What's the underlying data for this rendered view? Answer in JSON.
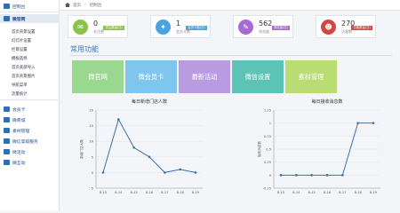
{
  "sidebar": {
    "items": [
      {
        "label": "控制台",
        "icon": "dashboard-icon",
        "type": "top",
        "active": false
      },
      {
        "label": "微官网",
        "icon": "home-site-icon",
        "type": "top",
        "active": true
      },
      {
        "label": "首页背景设置",
        "type": "sub"
      },
      {
        "label": "幻灯片设置",
        "type": "sub"
      },
      {
        "label": "栏目设置",
        "type": "sub"
      },
      {
        "label": "模板选择",
        "type": "sub"
      },
      {
        "label": "首页底部导入",
        "type": "sub"
      },
      {
        "label": "首页背景图片",
        "type": "sub"
      },
      {
        "label": "导航菜单",
        "type": "sub"
      },
      {
        "label": "流量统计",
        "type": "sub"
      },
      {
        "label": "会员卡",
        "icon": "member-card-icon",
        "type": "top"
      },
      {
        "label": "微商城",
        "icon": "shop-icon",
        "type": "top"
      },
      {
        "label": "素材管理",
        "icon": "material-icon",
        "type": "top"
      },
      {
        "label": "微信高级服务",
        "icon": "wechat-service-icon",
        "type": "top"
      },
      {
        "label": "微活动",
        "icon": "activity-icon",
        "type": "top"
      },
      {
        "label": "微互动",
        "icon": "interact-icon",
        "type": "top"
      }
    ]
  },
  "breadcrumb": {
    "home": "首页",
    "current": "控制台"
  },
  "stats": [
    {
      "value": "0",
      "label": "关注数",
      "badge": "关注数量(日)",
      "color": "#8bc34a",
      "icon": "wechat-icon"
    },
    {
      "value": "1",
      "label": "会员卡数",
      "badge": "会员卡数(日)",
      "color": "#4aa3df",
      "icon": "bird-icon"
    },
    {
      "value": "562",
      "label": "浏览量",
      "badge": "浏览量(日)",
      "color": "#a66bd5",
      "icon": "message-icon"
    },
    {
      "value": "270",
      "label": "访客数",
      "badge": "访客数量(日)",
      "color": "#d64545",
      "icon": "user-icon"
    }
  ],
  "common": {
    "title": "常用功能",
    "tiles": [
      {
        "label": "微官网",
        "color": "#9bd88f"
      },
      {
        "label": "微会员卡",
        "color": "#7fc6ee"
      },
      {
        "label": "最新活动",
        "color": "#b89be0"
      },
      {
        "label": "微信设置",
        "color": "#5cc4b6"
      },
      {
        "label": "素材管理",
        "color": "#b9dd72"
      }
    ]
  },
  "chart_data": [
    {
      "type": "line",
      "title": "每日新增门店人数",
      "ylabel": "新增门店人数",
      "categories": [
        "8-13",
        "8-14",
        "8-15",
        "8-16",
        "8-17",
        "8-18",
        "8-19"
      ],
      "values": [
        0,
        17,
        8,
        5,
        0,
        1,
        0
      ],
      "ylim": [
        -5,
        20
      ],
      "yticks": [
        -5,
        0,
        5,
        10,
        15,
        20
      ],
      "ytick_labels": [
        "-5",
        "0",
        "5",
        "10",
        "15",
        "20"
      ],
      "color": "#3e6fa8",
      "grid": true
    },
    {
      "type": "line",
      "title": "每日接收消息数",
      "ylabel": "接收消息数",
      "categories": [
        "8-13",
        "8-14",
        "8-15",
        "8-16",
        "8-17",
        "8-18",
        "8-19"
      ],
      "values": [
        0,
        0,
        0,
        0,
        0,
        1,
        1
      ],
      "ylim": [
        -0.25,
        1.25
      ],
      "yticks": [
        -0.25,
        0,
        0.25,
        0.5,
        0.75,
        1,
        1.25
      ],
      "ytick_labels": [
        "-0.25",
        "0",
        "0.25",
        "0.5",
        "0.75",
        "1",
        "1.25"
      ],
      "color": "#3e6fa8",
      "grid": true
    }
  ]
}
